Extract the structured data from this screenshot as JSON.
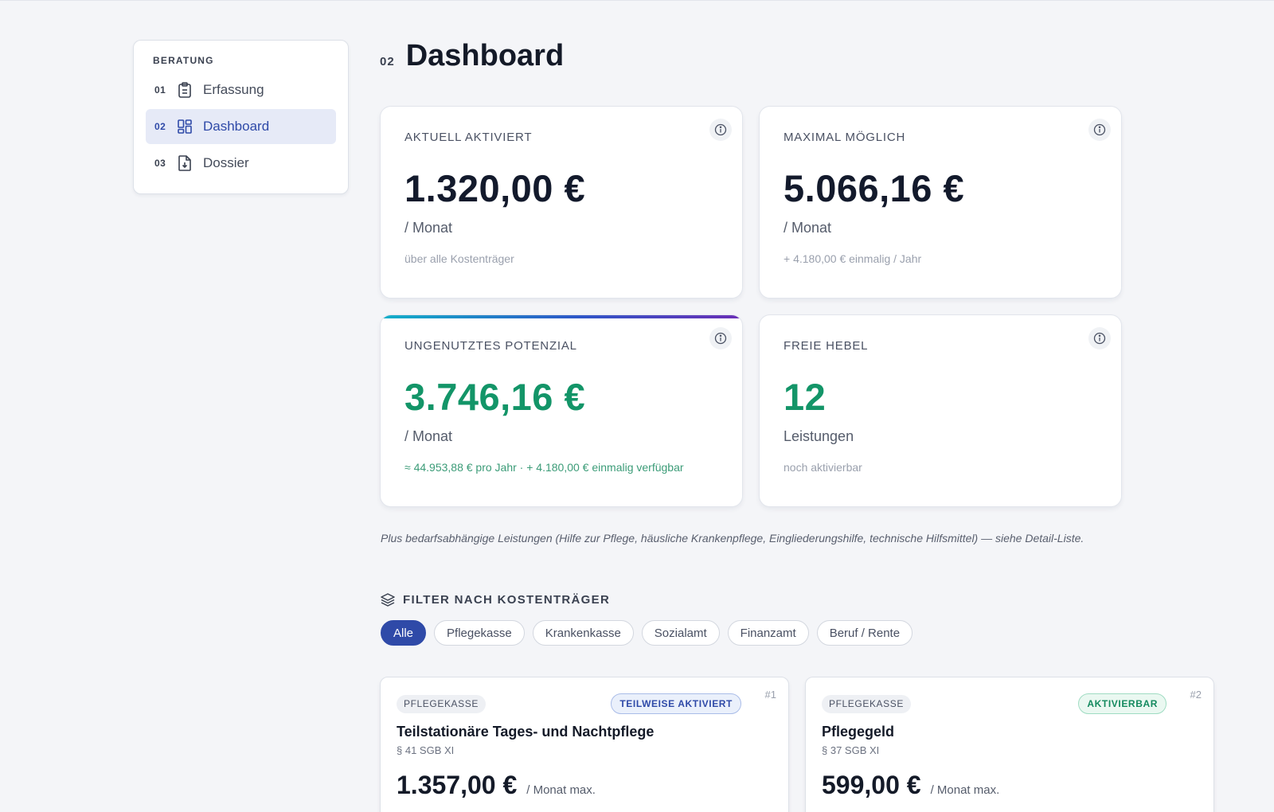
{
  "sidebar": {
    "section": "BERATUNG",
    "items": [
      {
        "num": "01",
        "label": "Erfassung",
        "icon": "clipboard-icon"
      },
      {
        "num": "02",
        "label": "Dashboard",
        "icon": "dashboard-grid-icon"
      },
      {
        "num": "03",
        "label": "Dossier",
        "icon": "file-download-icon"
      }
    ]
  },
  "page": {
    "num": "02",
    "title": "Dashboard"
  },
  "kpis": {
    "aktiviert": {
      "label": "AKTUELL AKTIVIERT",
      "value": "1.320,00 €",
      "unit": "/ Monat",
      "note": "über alle Kostenträger"
    },
    "maximal": {
      "label": "MAXIMAL MÖGLICH",
      "value": "5.066,16 €",
      "unit": "/ Monat",
      "note": "+ 4.180,00 € einmalig / Jahr"
    },
    "potenzial": {
      "label": "UNGENUTZTES POTENZIAL",
      "value": "3.746,16 €",
      "unit": "/ Monat",
      "note": "≈ 44.953,88 € pro Jahr · + 4.180,00 € einmalig verfügbar"
    },
    "hebel": {
      "label": "FREIE HEBEL",
      "value": "12",
      "unit": "Leistungen",
      "note": "noch aktivierbar"
    }
  },
  "footnote": "Plus bedarfsabhängige Leistungen (Hilfe zur Pflege, häusliche Krankenpflege, Eingliederungshilfe, technische Hilfsmittel) — siehe Detail-Liste.",
  "filter": {
    "title": "FILTER NACH KOSTENTRÄGER",
    "chips": [
      "Alle",
      "Pflegekasse",
      "Krankenkasse",
      "Sozialamt",
      "Finanzamt",
      "Beruf / Rente"
    ],
    "active": "Alle"
  },
  "leistungen": [
    {
      "tag": "PFLEGEKASSE",
      "status": "TEILWEISE AKTIVIERT",
      "rank": "#1",
      "title": "Teilstationäre Tages- und Nachtpflege",
      "law": "§ 41 SGB XI",
      "amount": "1.357,00 €",
      "unit": "/ Monat max."
    },
    {
      "tag": "PFLEGEKASSE",
      "status": "AKTIVIERBAR",
      "rank": "#2",
      "title": "Pflegegeld",
      "law": "§ 37 SGB XI",
      "amount": "599,00 €",
      "unit": "/ Monat max."
    }
  ],
  "colors": {
    "accent": "#2f4aa8",
    "positive": "#139568",
    "background": "#f4f5f8"
  }
}
